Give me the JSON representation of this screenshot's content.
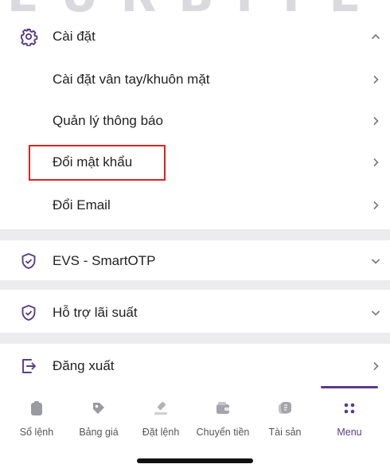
{
  "watermark": "EURBITE",
  "settings": {
    "title": "Cài đặt",
    "items": [
      {
        "label": "Cài đặt vân tay/khuôn mặt"
      },
      {
        "label": "Quản lý thông báo"
      },
      {
        "label": "Đổi mật khẩu"
      },
      {
        "label": "Đổi Email"
      }
    ]
  },
  "sections": {
    "smartotp": {
      "title": "EVS - SmartOTP"
    },
    "interest": {
      "title": "Hỗ trợ lãi suất"
    },
    "logout": {
      "title": "Đăng xuất"
    }
  },
  "tabs": [
    {
      "label": "Sổ lệnh",
      "icon": "clipboard-icon"
    },
    {
      "label": "Bảng giá",
      "icon": "price-tag-icon"
    },
    {
      "label": "Đặt lệnh",
      "icon": "gavel-icon"
    },
    {
      "label": "Chuyển tiền",
      "icon": "wallet-icon"
    },
    {
      "label": "Tài sản",
      "icon": "assets-icon"
    },
    {
      "label": "Menu",
      "icon": "menu-grid-icon",
      "active": true
    }
  ],
  "colors": {
    "accent": "#5b3c87",
    "highlight": "#e0221f",
    "divider": "#ececee"
  }
}
